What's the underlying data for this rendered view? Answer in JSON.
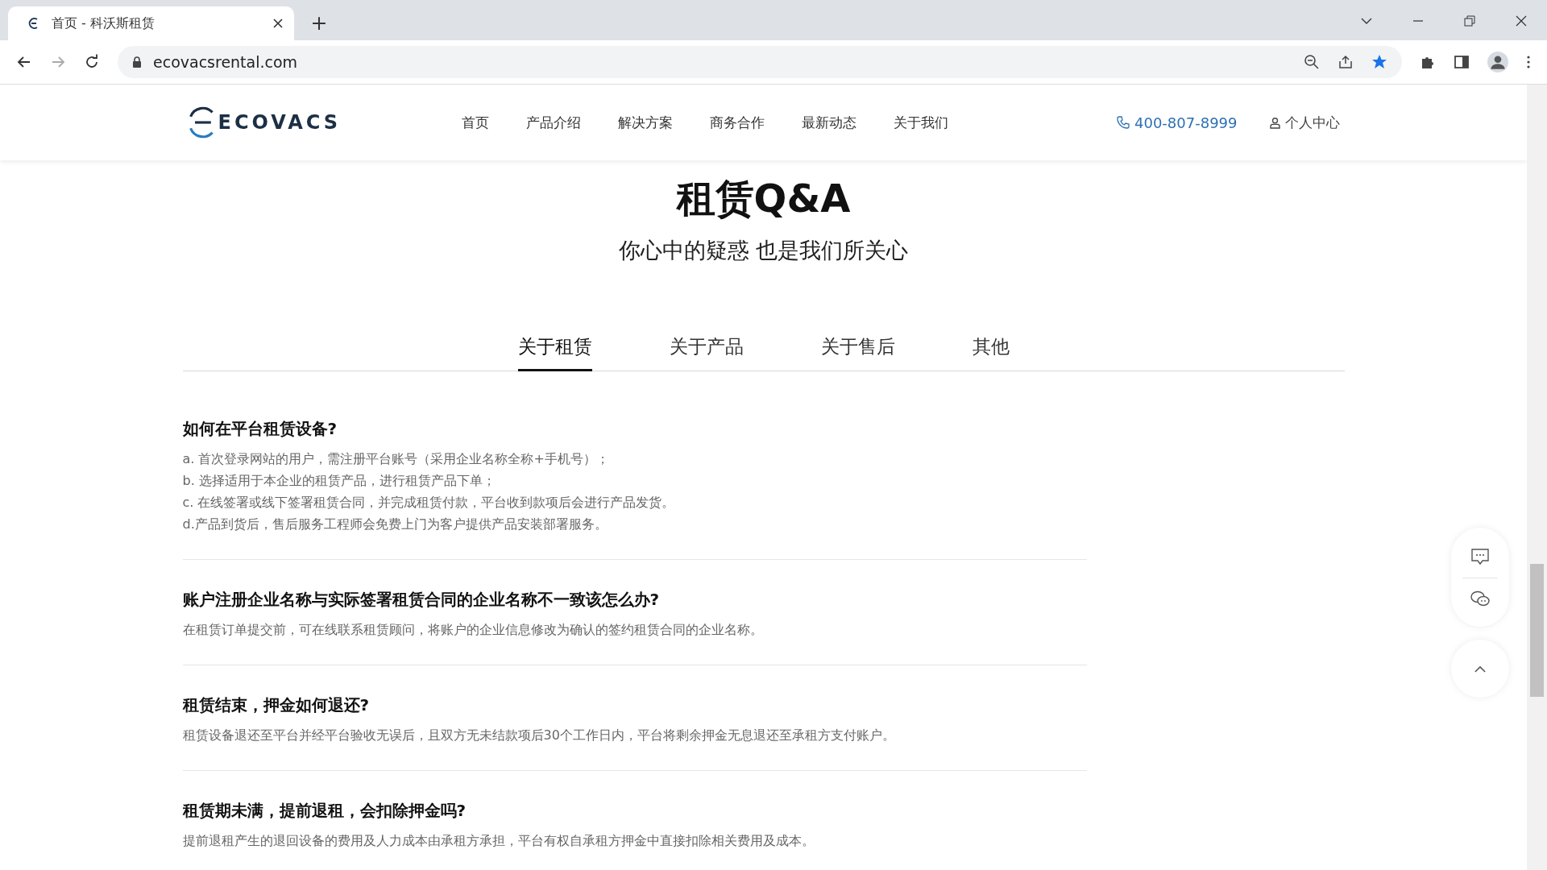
{
  "browser": {
    "tab_title": "首页 - 科沃斯租赁",
    "url": "ecovacsrental.com"
  },
  "header": {
    "logo": "ECOVACS",
    "nav": [
      "首页",
      "产品介绍",
      "解决方案",
      "商务合作",
      "最新动态",
      "关于我们"
    ],
    "phone": "400-807-8999",
    "account": "个人中心"
  },
  "hero": {
    "title": "租赁Q&A",
    "subtitle": "你心中的疑惑 也是我们所关心"
  },
  "tabs": [
    {
      "label": "关于租赁",
      "selected": true
    },
    {
      "label": "关于产品",
      "selected": false
    },
    {
      "label": "关于售后",
      "selected": false
    },
    {
      "label": "其他",
      "selected": false
    }
  ],
  "faq": [
    {
      "question": "如何在平台租赁设备?",
      "answer": [
        "a. 首次登录网站的用户，需注册平台账号（采用企业名称全称+手机号）；",
        "b. 选择适用于本企业的租赁产品，进行租赁产品下单；",
        "c. 在线签署或线下签署租赁合同，并完成租赁付款，平台收到款项后会进行产品发货。",
        "d.产品到货后，售后服务工程师会免费上门为客户提供产品安装部署服务。"
      ]
    },
    {
      "question": "账户注册企业名称与实际签署租赁合同的企业名称不一致该怎么办?",
      "answer": [
        "在租赁订单提交前，可在线联系租赁顾问，将账户的企业信息修改为确认的签约租赁合同的企业名称。"
      ]
    },
    {
      "question": "租赁结束，押金如何退还?",
      "answer": [
        "租赁设备退还至平台并经平台验收无误后，且双方无未结款项后30个工作日内，平台将剩余押金无息退还至承租方支付账户。"
      ]
    },
    {
      "question": "租赁期未满，提前退租，会扣除押金吗?",
      "answer": [
        "提前退租产生的退回设备的费用及人力成本由承租方承担，平台有权自承租方押金中直接扣除相关费用及成本。"
      ]
    }
  ]
}
